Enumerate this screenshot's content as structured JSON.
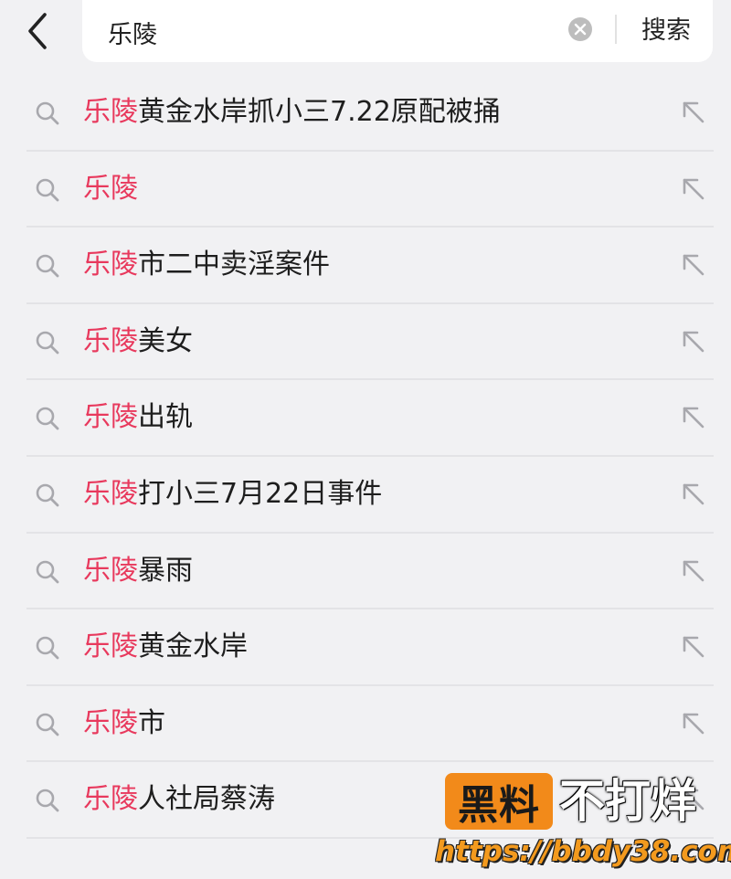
{
  "header": {
    "back_icon": "chevron-left-icon",
    "search_value": "乐陵",
    "clear_icon": "close-circle-icon",
    "search_button": "搜索"
  },
  "suggestions": [
    {
      "highlight": "乐陵",
      "rest": "黄金水岸抓小三7.22原配被捅"
    },
    {
      "highlight": "乐陵",
      "rest": ""
    },
    {
      "highlight": "乐陵",
      "rest": "市二中卖淫案件"
    },
    {
      "highlight": "乐陵",
      "rest": "美女"
    },
    {
      "highlight": "乐陵",
      "rest": "出轨"
    },
    {
      "highlight": "乐陵",
      "rest": "打小三7月22日事件"
    },
    {
      "highlight": "乐陵",
      "rest": "暴雨"
    },
    {
      "highlight": "乐陵",
      "rest": "黄金水岸"
    },
    {
      "highlight": "乐陵",
      "rest": "市"
    },
    {
      "highlight": "乐陵",
      "rest": "人社局蔡涛"
    }
  ],
  "watermark": {
    "badge": "黑料",
    "title": "不打烊",
    "url": "https://bbdy38.com"
  },
  "colors": {
    "highlight": "#e8395d",
    "background": "#f1f1f3",
    "watermark_orange": "#f28a1a"
  }
}
